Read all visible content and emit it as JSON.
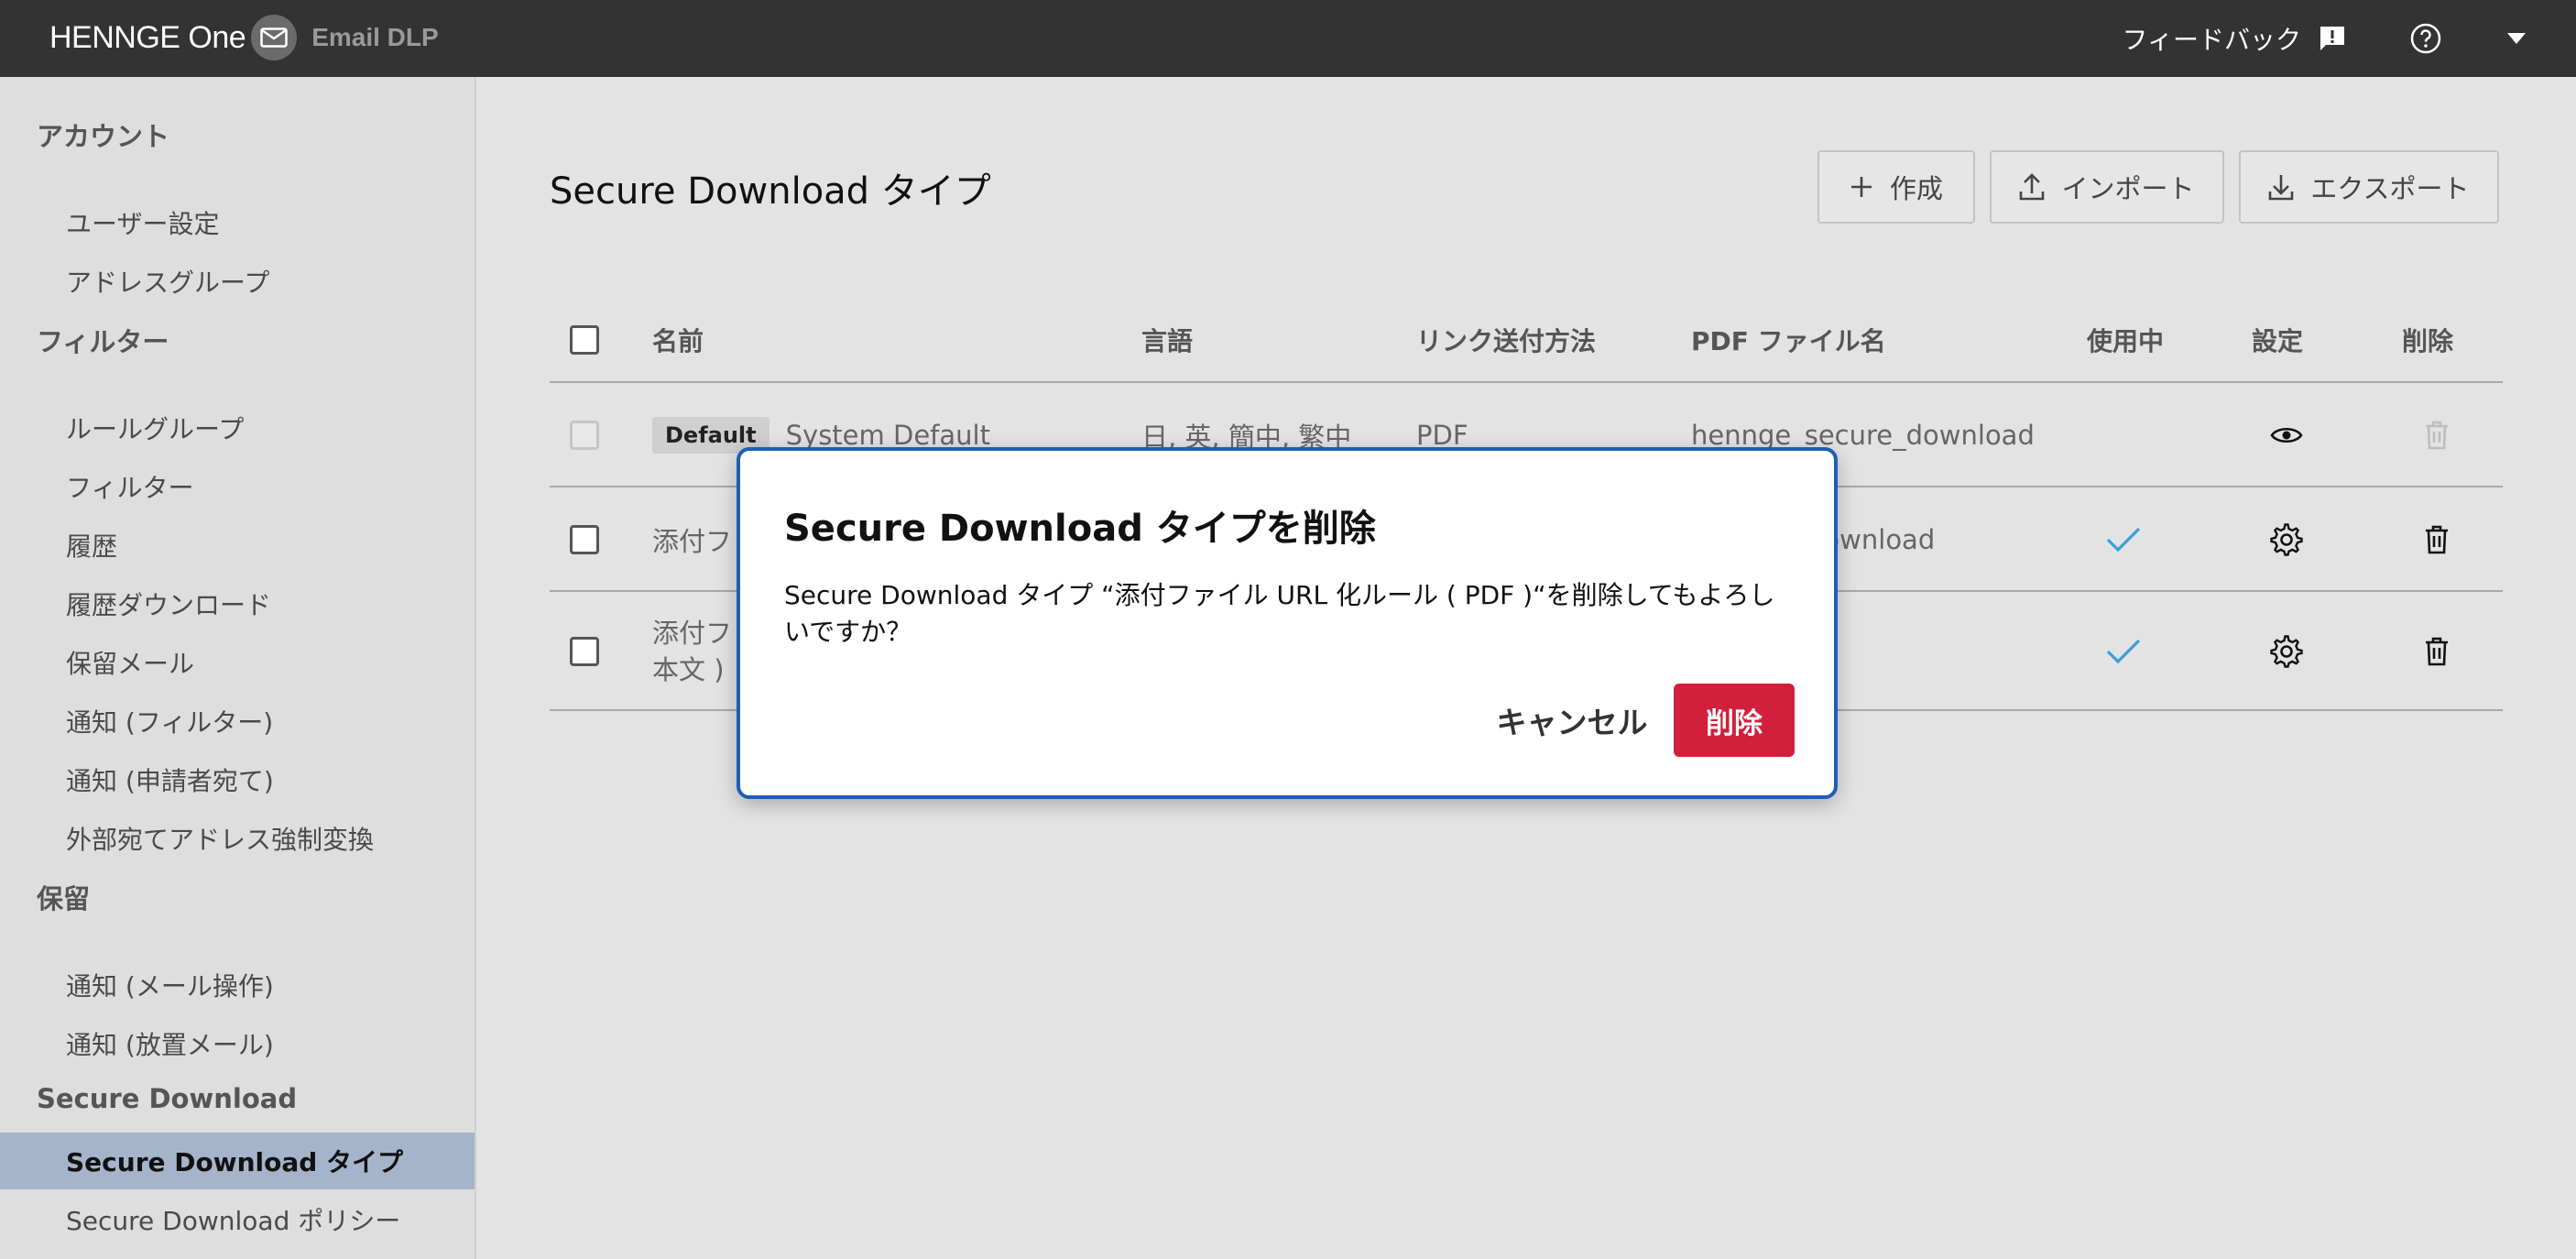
{
  "colors": {
    "topbar_bg": "#333333",
    "sidebar_bg": "#dedede",
    "sidebar_active_bg": "#a4b5cb",
    "main_bg": "#e3e3e3",
    "check_color": "#3a9ee0",
    "modal_border": "#1c5fb4",
    "danger": "#d21f3c"
  },
  "topbar": {
    "brand": "HENNGE One",
    "product": "Email DLP",
    "feedback_label": "フィードバック",
    "feedback_icon": "feedback-icon",
    "help_icon": "help-circle-icon",
    "menu_icon": "caret-down-icon"
  },
  "sidebar": {
    "sections": [
      {
        "title": "アカウント",
        "items": [
          {
            "label": "ユーザー設定"
          },
          {
            "label": "アドレスグループ"
          }
        ]
      },
      {
        "title": "フィルター",
        "items": [
          {
            "label": "ルールグループ"
          },
          {
            "label": "フィルター"
          },
          {
            "label": "履歴"
          },
          {
            "label": "履歴ダウンロード"
          },
          {
            "label": "保留メール"
          },
          {
            "label": "通知 (フィルター)"
          },
          {
            "label": "通知 (申請者宛て)"
          },
          {
            "label": "外部宛てアドレス強制変換"
          }
        ]
      },
      {
        "title": "保留",
        "items": [
          {
            "label": "通知 (メール操作)"
          },
          {
            "label": "通知 (放置メール)"
          }
        ]
      },
      {
        "title": "Secure Download",
        "items": [
          {
            "label": "Secure Download タイプ",
            "active": true
          },
          {
            "label": "Secure Download ポリシー"
          }
        ]
      }
    ]
  },
  "main": {
    "title": "Secure Download タイプ",
    "toolbar": {
      "create_label": "作成",
      "import_label": "インポート",
      "export_label": "エクスポート"
    },
    "table": {
      "headers": {
        "name": "名前",
        "language": "言語",
        "link_method": "リンク送付方法",
        "pdf_filename": "PDF ファイル名",
        "in_use": "使用中",
        "settings": "設定",
        "delete": "削除"
      },
      "rows": [
        {
          "badge": "Default",
          "name": "System Default",
          "language": "日, 英, 簡中, 繁中",
          "link_method": "PDF",
          "pdf_filename": "hennge_secure_download",
          "in_use": false,
          "settings_icon": "eye-icon",
          "delete_disabled": true
        },
        {
          "name": "添付フ",
          "pdf_filename": "ure_download",
          "in_use": true,
          "settings_icon": "gear-icon",
          "delete_disabled": false
        },
        {
          "name_line1": "添付フ",
          "name_line2": "本文 )",
          "in_use": true,
          "settings_icon": "gear-icon",
          "delete_disabled": false
        }
      ]
    }
  },
  "modal": {
    "title": "Secure Download タイプを削除",
    "body": "Secure Download タイプ “添付ファイル URL 化ルール ( PDF )“を削除してもよろしいですか？",
    "cancel_label": "キャンセル",
    "delete_label": "削除"
  }
}
